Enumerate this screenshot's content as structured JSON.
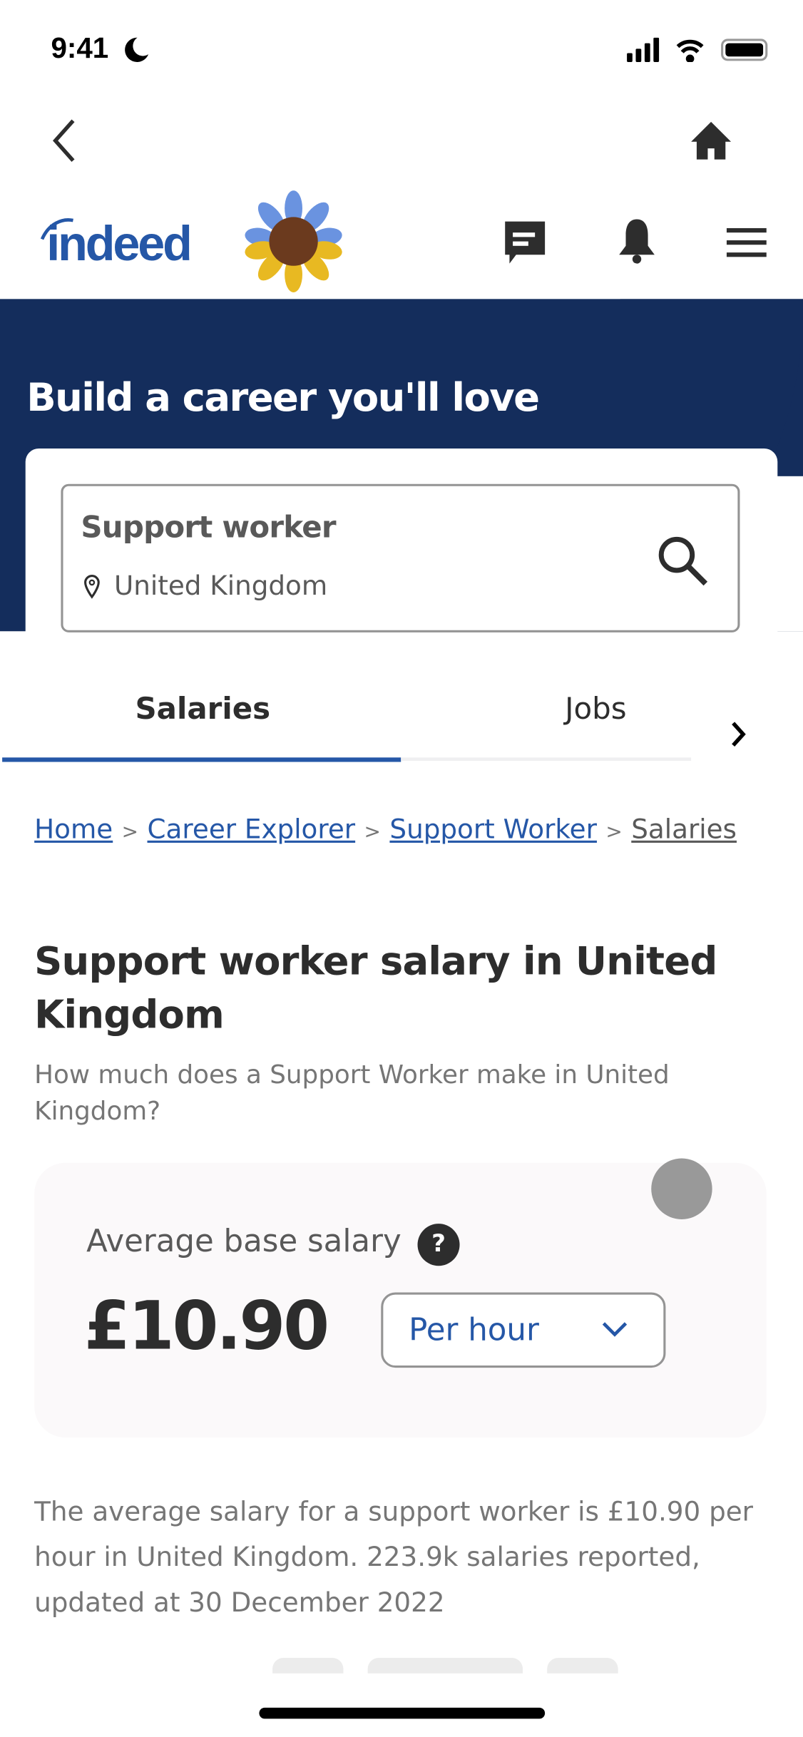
{
  "status_bar": {
    "time": "9:41",
    "icons": [
      "moon-icon",
      "signal-icon",
      "wifi-icon",
      "battery-icon"
    ]
  },
  "nav": {
    "back_icon": "chevron-left-icon",
    "home_icon": "home-icon"
  },
  "header": {
    "logo": "indeed",
    "icons": [
      "message-icon",
      "bell-icon",
      "menu-icon"
    ]
  },
  "hero": {
    "title": "Build a career you'll love",
    "search": {
      "query": "Support worker",
      "location": "United Kingdom"
    }
  },
  "tabs": [
    {
      "label": "Salaries",
      "active": true
    },
    {
      "label": "Jobs",
      "active": false
    }
  ],
  "breadcrumb": [
    {
      "label": "Home"
    },
    {
      "label": "Career Explorer"
    },
    {
      "label": "Support Worker"
    },
    {
      "label": "Salaries"
    }
  ],
  "page": {
    "title": "Support worker salary in United Kingdom",
    "subtitle": "How much does a Support Worker make in United Kingdom?"
  },
  "salary": {
    "label": "Average base salary",
    "amount": "£10.90",
    "period": "Per hour"
  },
  "summary": "The average salary for a support worker is £10.90 per hour in United Kingdom.  223.9k salaries reported, updated at 30 December 2022",
  "colors": {
    "brand": "#2557a7",
    "banner": "#142d5c"
  }
}
